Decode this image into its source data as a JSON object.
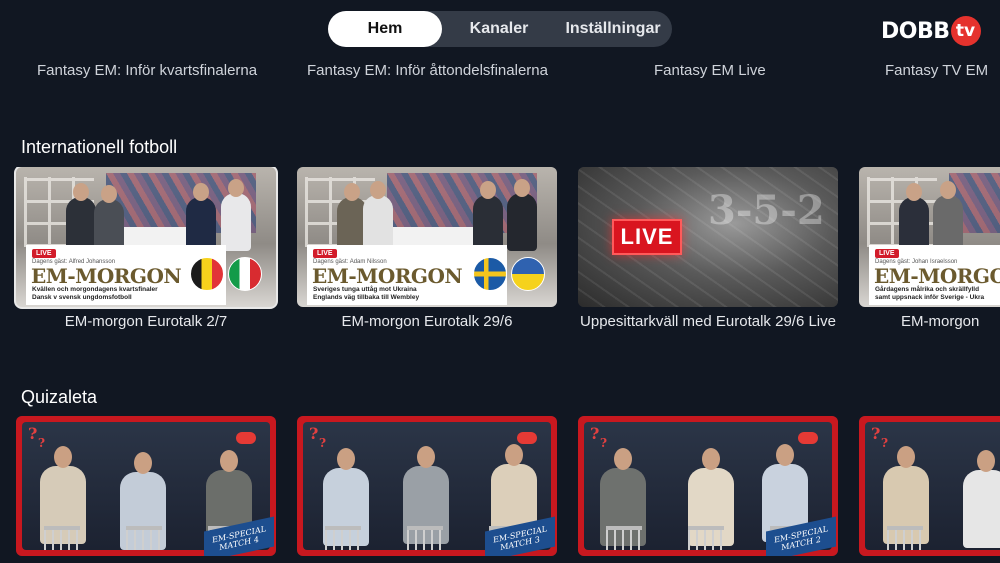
{
  "nav": {
    "tabs": [
      {
        "label": "Hem",
        "selected": true
      },
      {
        "label": "Kanaler",
        "selected": false
      },
      {
        "label": "Inställningar",
        "selected": false
      }
    ]
  },
  "logo": {
    "text": "DOBB",
    "badge": "tv",
    "accent": "#e5322d"
  },
  "top_row": {
    "captions": [
      "Fantasy EM: Inför kvartsfinalerna",
      "Fantasy EM: Inför åttondelsfinalerna",
      "Fantasy EM Live",
      "Fantasy TV EM"
    ]
  },
  "sections": [
    {
      "title": "Internationell fotboll",
      "cards": [
        {
          "caption": "EM-morgon Eurotalk 2/7",
          "focused": true,
          "thumb": {
            "type": "studio",
            "live_tag": "LIVE",
            "guest": "Dagens gäst: Alfred Johansson",
            "headline": "EM-MORGON",
            "sub1": "Kvällen och morgondagens kvartsfinaler",
            "sub2": "Dansk v svensk ungdomsfotboll",
            "flags": [
              "be",
              "it"
            ]
          }
        },
        {
          "caption": "EM-morgon Eurotalk 29/6",
          "focused": false,
          "thumb": {
            "type": "studio",
            "live_tag": "LIVE",
            "guest": "Dagens gäst: Adam Nilsson",
            "headline": "EM-MORGON",
            "sub1": "Sveriges tunga uttåg mot Ukraina",
            "sub2": "Englands väg tillbaka till Wembley",
            "flags": [
              "se",
              "ua"
            ]
          }
        },
        {
          "caption": "Uppesittarkväll med Eurotalk 29/6 Live",
          "focused": false,
          "thumb": {
            "type": "live",
            "badge": "LIVE",
            "bg_text": "3-5-2"
          }
        },
        {
          "caption": "EM-morgon",
          "focused": false,
          "thumb": {
            "type": "studio",
            "live_tag": "LIVE",
            "guest": "Dagens gäst: Johan Israelsson",
            "headline": "EM-MORGON",
            "sub1": "Gårdagens målrika och skrällfylld",
            "sub2": "samt uppsnack inför Sverige - Ukra",
            "flags": []
          }
        }
      ]
    },
    {
      "title": "Quizaleta",
      "cards": [
        {
          "thumb": {
            "type": "quiz",
            "ribbon1": "EM-SPECIAL",
            "ribbon2": "MATCH 4"
          }
        },
        {
          "thumb": {
            "type": "quiz",
            "ribbon1": "EM-SPECIAL",
            "ribbon2": "MATCH 3"
          }
        },
        {
          "thumb": {
            "type": "quiz",
            "ribbon1": "EM-SPECIAL",
            "ribbon2": "MATCH 2"
          }
        },
        {
          "thumb": {
            "type": "quiz",
            "ribbon1": "",
            "ribbon2": ""
          }
        }
      ]
    }
  ]
}
